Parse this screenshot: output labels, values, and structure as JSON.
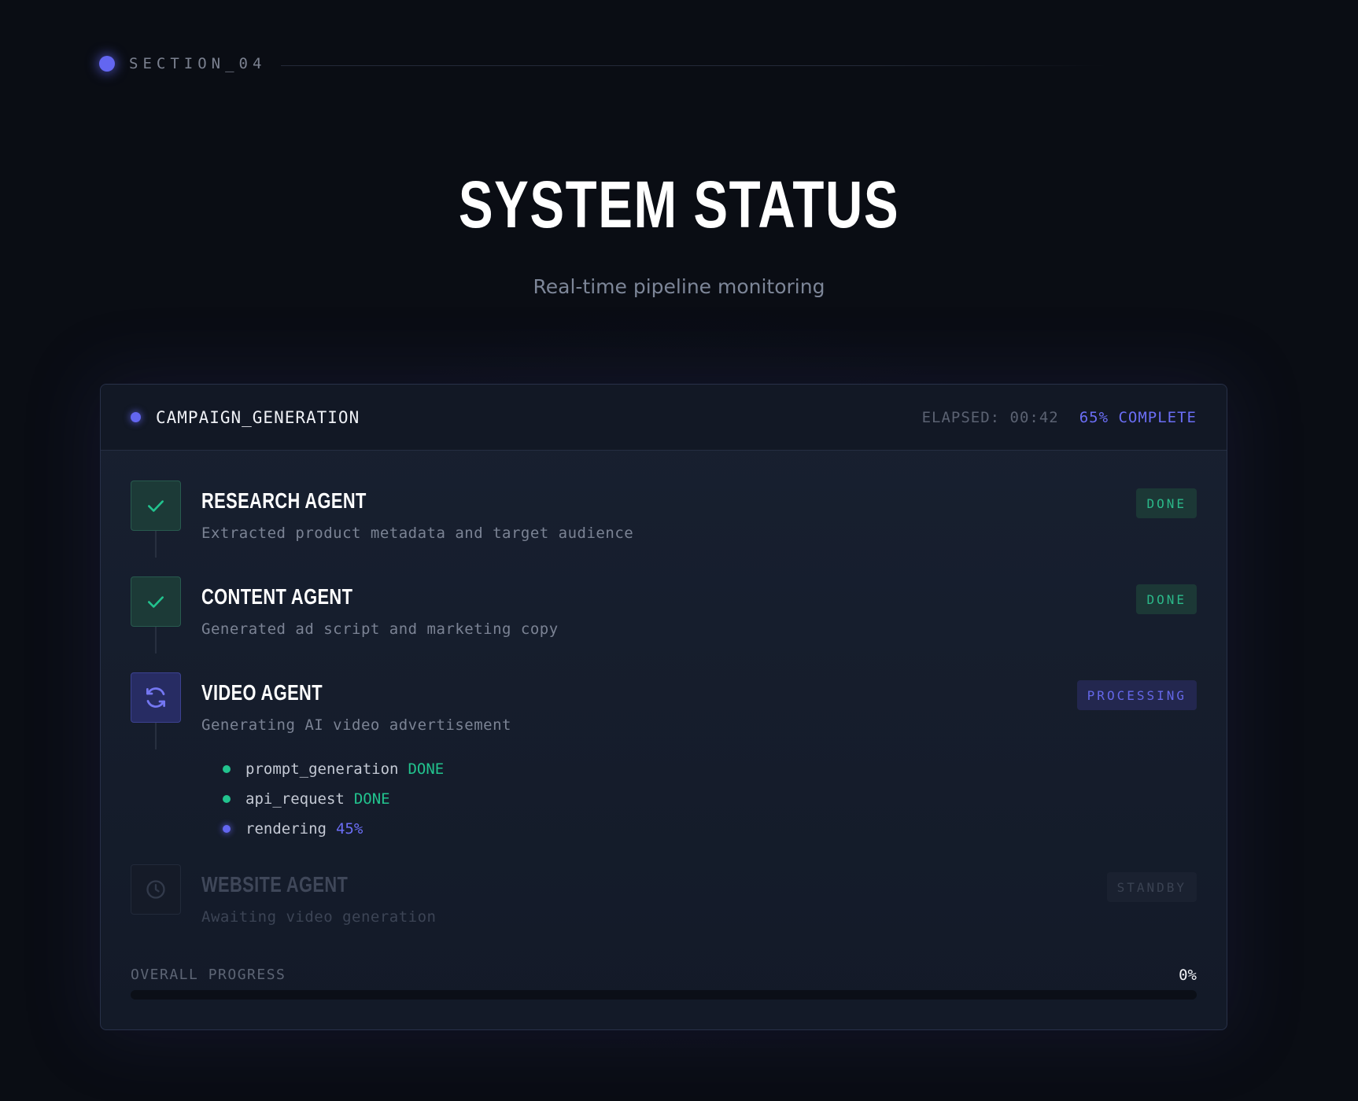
{
  "section": {
    "label": "SECTION_04"
  },
  "hero": {
    "title": "SYSTEM STATUS",
    "subtitle": "Real-time pipeline monitoring"
  },
  "panel": {
    "title": "CAMPAIGN_GENERATION",
    "elapsed": "ELAPSED: 00:42",
    "complete": "65% COMPLETE",
    "agents": [
      {
        "name": "RESEARCH AGENT",
        "description": "Extracted product metadata and target audience",
        "status": "DONE",
        "icon": "check-icon"
      },
      {
        "name": "CONTENT AGENT",
        "description": "Generated ad script and marketing copy",
        "status": "DONE",
        "icon": "check-icon"
      },
      {
        "name": "VIDEO AGENT",
        "description": "Generating AI video advertisement",
        "status": "PROCESSING",
        "icon": "refresh-icon",
        "subtasks": [
          {
            "name": "prompt_generation",
            "status": "DONE"
          },
          {
            "name": "api_request",
            "status": "DONE"
          },
          {
            "name": "rendering",
            "status": "45%"
          }
        ]
      },
      {
        "name": "WEBSITE AGENT",
        "description": "Awaiting video generation",
        "status": "STANDBY",
        "icon": "clock-icon"
      }
    ],
    "progress": {
      "label": "OVERALL PROGRESS",
      "value_text": "0%",
      "fraction": 0
    }
  },
  "colors": {
    "accent": "#6366f1",
    "success": "#22c38e",
    "background": "#0a0d14",
    "panel": "#182030"
  }
}
